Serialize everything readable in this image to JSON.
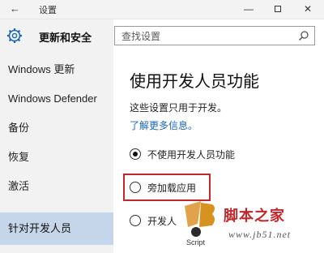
{
  "window": {
    "back_icon": "back-arrow-icon",
    "title": "设置",
    "minimize": "—",
    "close": "✕"
  },
  "sidebar": {
    "header_icon": "gear-icon",
    "title": "更新和安全",
    "items": [
      {
        "label": "Windows 更新"
      },
      {
        "label": "Windows Defender"
      },
      {
        "label": "备份"
      },
      {
        "label": "恢复"
      },
      {
        "label": "激活"
      },
      {
        "label": "针对开发人员",
        "selected": true
      }
    ]
  },
  "search": {
    "placeholder": "查找设置",
    "icon": "search-icon"
  },
  "main": {
    "title": "使用开发人员功能",
    "description": "这些设置只用于开发。",
    "link": "了解更多信息。",
    "options": [
      {
        "label": "不使用开发人员功能",
        "checked": true
      },
      {
        "label": "旁加载应用",
        "checked": false,
        "highlighted": true
      },
      {
        "label": "开发人",
        "checked": false
      }
    ]
  },
  "watermark": {
    "mark": "jb51-logo",
    "script_text": "Script",
    "site_name": "脚本之家",
    "url": "www.jb51.net"
  },
  "colors": {
    "sidebar_bg": "#f2f2f2",
    "selected_bg": "#c5d6ea",
    "link": "#1a66b5",
    "highlight": "#c0282c"
  }
}
